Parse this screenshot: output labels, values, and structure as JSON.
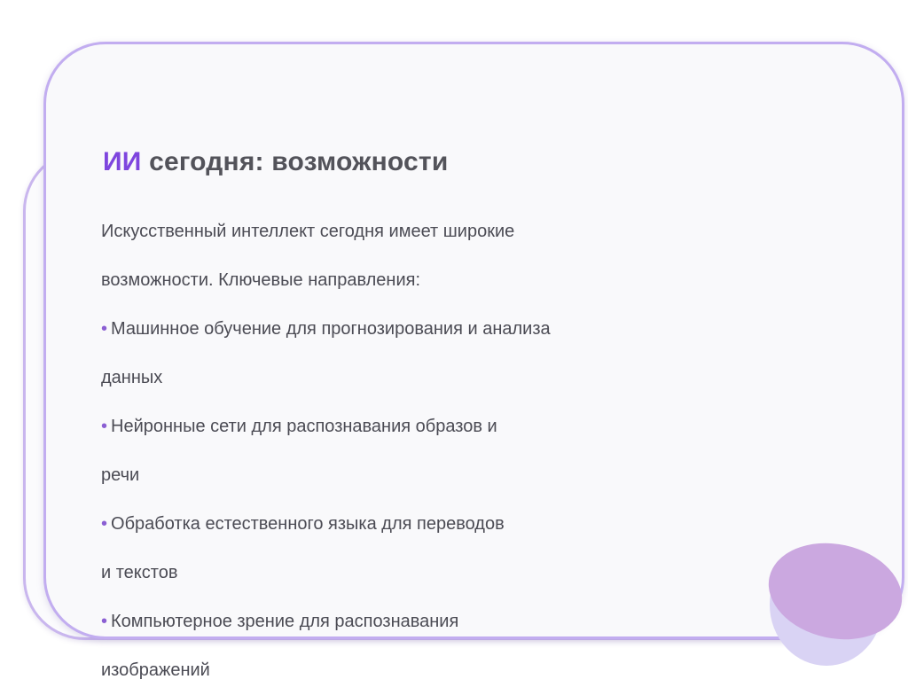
{
  "slide": {
    "title_accent": "ИИ",
    "title_rest": " сегодня: возможности",
    "intro_line1": "Искусственный интеллект сегодня имеет широкие",
    "intro_line2": "возможности. Ключевые направления:",
    "bullet_char": "•",
    "bullets": [
      {
        "line1": "Машинное обучение для прогнозирования и анализа",
        "line2": "данных"
      },
      {
        "line1": "Нейронные сети для распознавания образов и",
        "line2": "речи"
      },
      {
        "line1": "Обработка естественного языка для переводов",
        "line2": "и текстов"
      },
      {
        "line1": "Компьютерное зрение для распознавания",
        "line2": "изображений"
      }
    ]
  },
  "colors": {
    "accent": "#7e45de",
    "card_border": "#c2adf0",
    "deco_light": "#d9d3f4",
    "deco_dark": "#cba8e0",
    "text": "#4b4b54"
  }
}
